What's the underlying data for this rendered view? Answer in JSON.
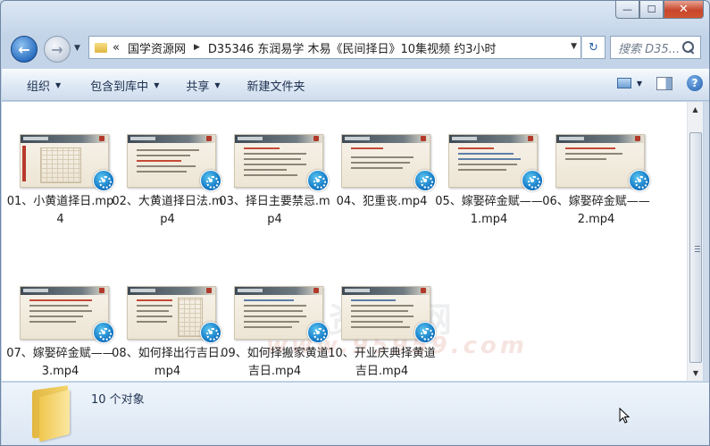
{
  "window": {
    "caption": {
      "minimize": "—",
      "maximize": "☐",
      "close": "✕"
    }
  },
  "nav": {
    "back_glyph": "←",
    "forward_glyph": "→",
    "dropdown_glyph": "▼",
    "address": {
      "overflow": "«",
      "segments": [
        "国学资源网",
        "D35346 东润易学 木易《民间择日》10集视频 约3小时"
      ],
      "separator": "▶",
      "dropdown_glyph": "▼"
    },
    "refresh_glyph": "↻",
    "search_placeholder": "搜索 D35..."
  },
  "toolbar": {
    "items": [
      {
        "label": "组织",
        "dropdown": "▼"
      },
      {
        "label": "包含到库中",
        "dropdown": "▼"
      },
      {
        "label": "共享",
        "dropdown": "▼"
      },
      {
        "label": "新建文件夹",
        "dropdown": ""
      }
    ],
    "view_dropdown": "▼",
    "help_glyph": "?"
  },
  "files": [
    {
      "name": "01、小黄道择日.mp4"
    },
    {
      "name": "02、大黄道择日法.mp4"
    },
    {
      "name": "03、择日主要禁忌.mp4"
    },
    {
      "name": "04、犯重丧.mp4"
    },
    {
      "name": "05、嫁娶碎金赋——1.mp4"
    },
    {
      "name": "06、嫁娶碎金赋——2.mp4"
    },
    {
      "name": "07、嫁娶碎金赋——3.mp4"
    },
    {
      "name": "08、如何择出行吉日.mp4"
    },
    {
      "name": "09、如何择搬家黄道吉日.mp4"
    },
    {
      "name": "10、开业庆典择黄道吉日.mp4"
    }
  ],
  "watermark": {
    "line1": "国学资源网",
    "line2": "www.95959.com"
  },
  "scrollbar": {
    "up": "▲",
    "down": "▼"
  },
  "details": {
    "count": "10 个对象"
  }
}
